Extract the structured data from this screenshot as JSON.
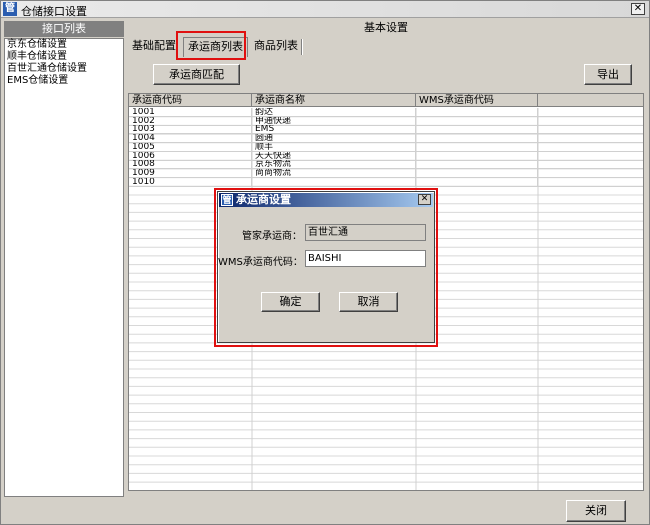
{
  "window": {
    "title": "仓储接口设置",
    "icon_char": "管",
    "close_glyph": "✕"
  },
  "left_pane": {
    "header": "接口列表",
    "items": [
      {
        "label": "京东仓储设置"
      },
      {
        "label": "顺丰仓储设置"
      },
      {
        "label": "百世汇通仓储设置"
      },
      {
        "label": "EMS仓储设置"
      }
    ]
  },
  "right_pane": {
    "header": "基本设置",
    "tabs": [
      {
        "label": "基础配置"
      },
      {
        "label": "承运商列表",
        "active": true
      },
      {
        "label": "商品列表"
      }
    ],
    "carrier_match_button": "承运商匹配",
    "export_button": "导出",
    "close_button": "关闭"
  },
  "grid": {
    "columns": [
      "承运商代码",
      "承运商名称",
      "WMS承运商代码",
      ""
    ],
    "rows": [
      {
        "code": "1001",
        "name": "韵达",
        "wms": ""
      },
      {
        "code": "1002",
        "name": "申通快递",
        "wms": ""
      },
      {
        "code": "1003",
        "name": "EMS",
        "wms": ""
      },
      {
        "code": "1004",
        "name": "圆通",
        "wms": ""
      },
      {
        "code": "1005",
        "name": "顺丰",
        "wms": ""
      },
      {
        "code": "1006",
        "name": "天天快递",
        "wms": ""
      },
      {
        "code": "1008",
        "name": "京东物流",
        "wms": ""
      },
      {
        "code": "1009",
        "name": "尚尚物流",
        "wms": ""
      },
      {
        "code": "1010",
        "name": "",
        "wms": ""
      }
    ]
  },
  "dialog": {
    "title": "承运商设置",
    "icon_char": "管",
    "close_glyph": "✕",
    "steward_label": "管家承运商：",
    "steward_value": "百世汇通",
    "wms_label": "WMS承运商代码：",
    "wms_value": "BAISHI",
    "ok_button": "确定",
    "cancel_button": "取消"
  },
  "colors": {
    "highlight": "#e01010",
    "dialog_title_start": "#0a246a",
    "dialog_title_end": "#a6caf0",
    "face": "#d4d0c8"
  }
}
